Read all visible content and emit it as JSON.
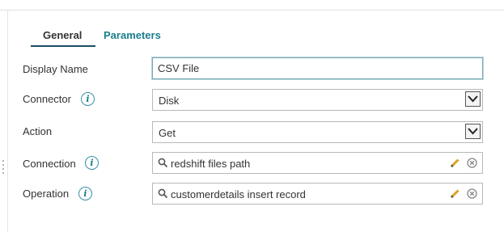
{
  "tabs": [
    {
      "label": "General",
      "active": true
    },
    {
      "label": "Parameters",
      "active": false
    }
  ],
  "form": {
    "display_name": {
      "label": "Display Name",
      "value": "CSV File"
    },
    "connector": {
      "label": "Connector",
      "value": "Disk"
    },
    "action": {
      "label": "Action",
      "value": "Get"
    },
    "connection": {
      "label": "Connection",
      "value": "redshift files path"
    },
    "operation": {
      "label": "Operation",
      "value": "customerdetails insert record"
    }
  },
  "icons": {
    "info": "info-icon",
    "search": "search-icon",
    "edit": "pencil-icon",
    "clear": "clear-icon",
    "dropdown": "chevron-down-icon"
  },
  "colors": {
    "accent": "#1a7f8e",
    "tab_underline": "#1d4e63",
    "info": "#3a8fa4",
    "pencil": "#e0a020"
  }
}
